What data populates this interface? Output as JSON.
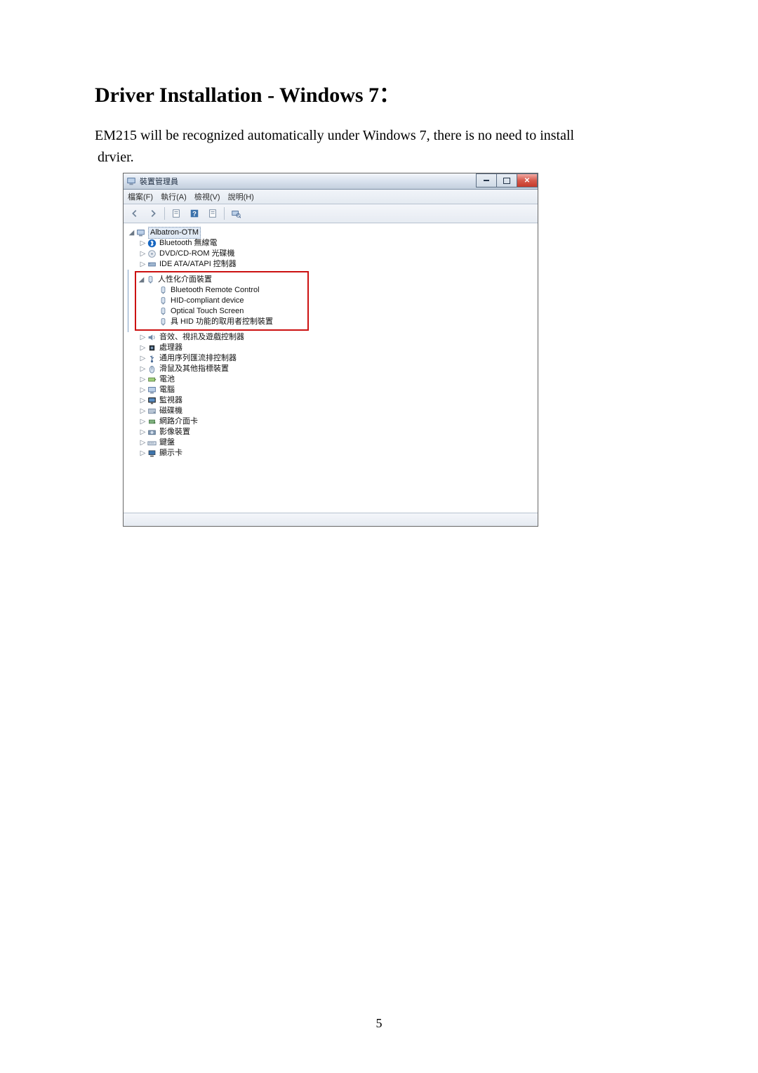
{
  "document": {
    "title": "Driver Installation - Windows 7：",
    "paragraph_line1": "EM215 will be recognized automatically under Windows 7, there is no need to install",
    "paragraph_line2": "drvier.",
    "page_number": "5"
  },
  "device_manager": {
    "window_title": "裝置管理員",
    "menus": {
      "file": "檔案(F)",
      "action": "執行(A)",
      "view": "檢視(V)",
      "help": "說明(H)"
    },
    "toolbar_icons": [
      "back",
      "forward",
      "sep",
      "properties",
      "help",
      "properties2",
      "scan",
      "sep"
    ],
    "root_node": "Albatron-OTM",
    "top_collapsed": [
      {
        "label": "Bluetooth 無線電",
        "icon": "bluetooth"
      },
      {
        "label": "DVD/CD-ROM 光碟機",
        "icon": "disc"
      },
      {
        "label": "IDE ATA/ATAPI 控制器",
        "icon": "ide"
      }
    ],
    "hid_group": {
      "label": "人性化介面裝置",
      "children": [
        "Bluetooth Remote Control",
        "HID-compliant device",
        "Optical Touch Screen",
        "具 HID 功能的取用者控制裝置"
      ]
    },
    "bottom_collapsed": [
      {
        "label": "音效、視訊及遊戲控制器",
        "icon": "sound"
      },
      {
        "label": "處理器",
        "icon": "cpu"
      },
      {
        "label": "通用序列匯流排控制器",
        "icon": "usb"
      },
      {
        "label": "滑鼠及其他指標裝置",
        "icon": "mouse"
      },
      {
        "label": "電池",
        "icon": "battery"
      },
      {
        "label": "電腦",
        "icon": "computer"
      },
      {
        "label": "監視器",
        "icon": "monitor"
      },
      {
        "label": "磁碟機",
        "icon": "disk"
      },
      {
        "label": "網路介面卡",
        "icon": "network"
      },
      {
        "label": "影像裝置",
        "icon": "camera"
      },
      {
        "label": "鍵盤",
        "icon": "keyboard"
      },
      {
        "label": "顯示卡",
        "icon": "display"
      }
    ]
  }
}
